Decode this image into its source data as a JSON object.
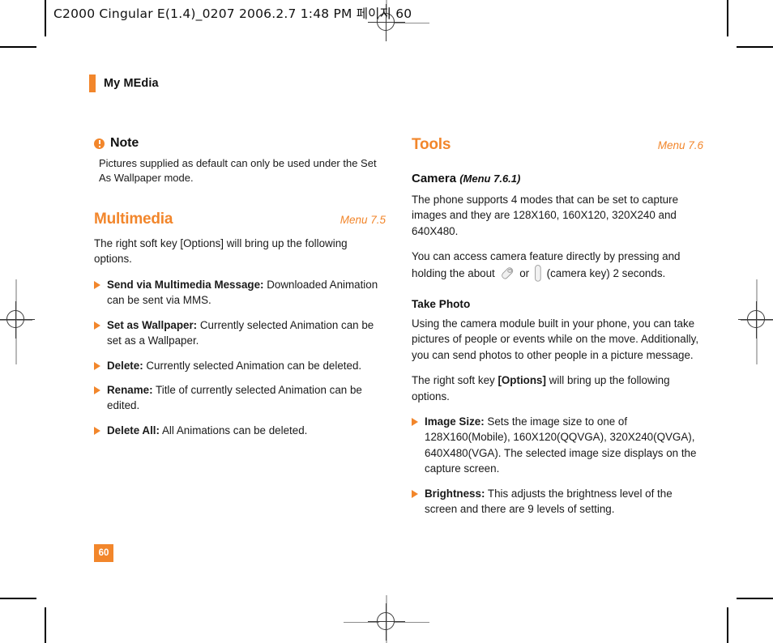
{
  "printer_header": "C2000 Cingular  E(1.4)_0207  2006.2.7 1:48 PM 페이지 60",
  "running_head": {
    "label": "My MEdia"
  },
  "page_number": "60",
  "left_column": {
    "note": {
      "title": "Note",
      "icon": "exclamation-icon",
      "body": "Pictures supplied as default can only be used under the Set As Wallpaper mode."
    },
    "multimedia": {
      "title": "Multimedia",
      "menu_ref": "Menu 7.5",
      "intro": "The right soft key [Options] will bring up the following options.",
      "options": [
        {
          "label": "Send via Multimedia Message:",
          "text": " Downloaded Animation can be sent via MMS."
        },
        {
          "label": "Set as Wallpaper:",
          "text": " Currently selected Animation can be set as a Wallpaper."
        },
        {
          "label": "Delete:",
          "text": " Currently selected Animation can be deleted."
        },
        {
          "label": "Rename:",
          "text": " Title of currently selected Animation can be edited."
        },
        {
          "label": "Delete All:",
          "text": " All Animations can be deleted."
        }
      ]
    }
  },
  "right_column": {
    "tools": {
      "title": "Tools",
      "menu_ref": "Menu 7.6"
    },
    "camera": {
      "title": "Camera",
      "menu_ref": "(Menu 7.6.1)",
      "paragraph_1": "The phone supports 4 modes that can be set to capture images and they are 128X160, 160X120, 320X240 and 640X480.",
      "paragraph_2_part_1": "You can access camera feature directly by pressing and holding the about",
      "paragraph_2_part_2": "or",
      "paragraph_2_part_3": "(camera key) 2 seconds.",
      "key_icon_1": "side-key-icon",
      "key_icon_2": "camera-key-icon"
    },
    "take_photo": {
      "title": "Take Photo",
      "paragraph_1": "Using the camera module built in your phone, you can take pictures of people or events while on the move. Additionally, you can send photos to other people in a picture message.",
      "paragraph_2_part_1": "The right soft key ",
      "paragraph_2_bold": "[Options]",
      "paragraph_2_part_2": " will bring up the following options.",
      "options": [
        {
          "label": "Image Size:",
          "text": " Sets the image size to one of 128X160(Mobile), 160X120(QQVGA), 320X240(QVGA), 640X480(VGA). The selected image size displays on the capture screen."
        },
        {
          "label": "Brightness:",
          "text": " This adjusts the brightness level of the screen and there are 9 levels of setting."
        }
      ]
    }
  },
  "colors": {
    "accent": "#f2862b",
    "text": "#1a1a1a"
  }
}
